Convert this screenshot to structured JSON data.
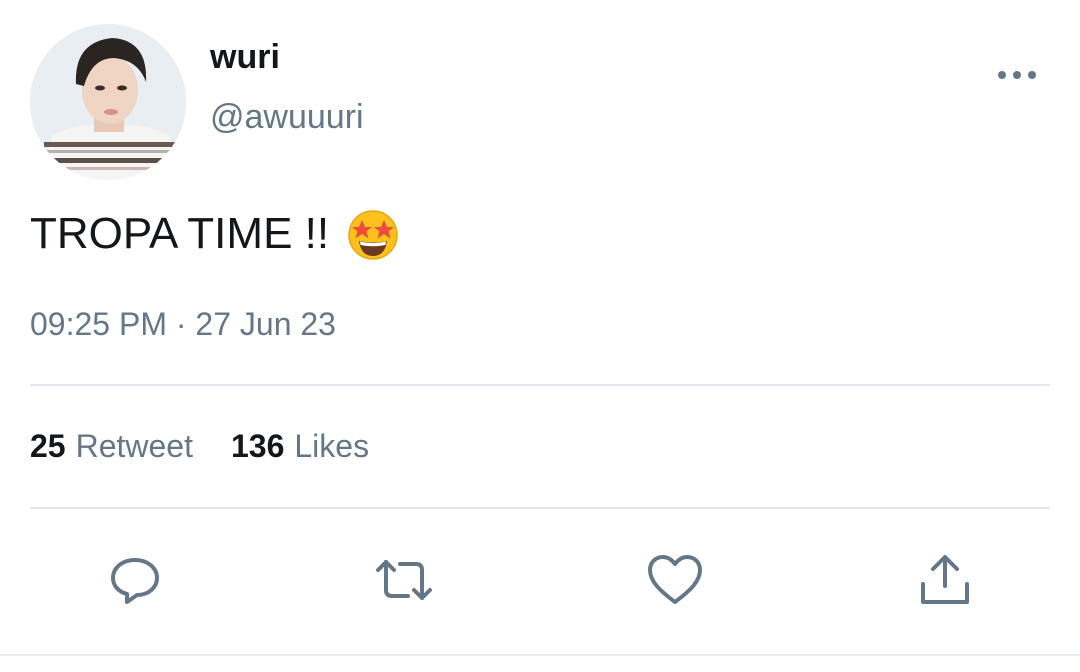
{
  "user": {
    "display_name": "wuri",
    "handle": "@awuuuri",
    "avatar_icon": "profile-photo"
  },
  "tweet": {
    "text": "TROPA TIME !!",
    "emoji": "star-struck-emoji",
    "timestamp": "09:25 PM · 27 Jun 23"
  },
  "stats": {
    "retweets_count": "25",
    "retweets_label": "Retweet",
    "likes_count": "136",
    "likes_label": "Likes"
  },
  "actions": [
    {
      "name": "reply",
      "icon": "comment-bubble-icon"
    },
    {
      "name": "retweet",
      "icon": "retweet-arrows-icon"
    },
    {
      "name": "like",
      "icon": "heart-icon"
    },
    {
      "name": "share",
      "icon": "share-upload-icon"
    }
  ],
  "menu": {
    "icon": "more-dots-icon"
  },
  "colors": {
    "text_primary": "#14171a",
    "text_secondary": "#657786",
    "divider": "#e1e8ed",
    "background": "#ffffff"
  }
}
